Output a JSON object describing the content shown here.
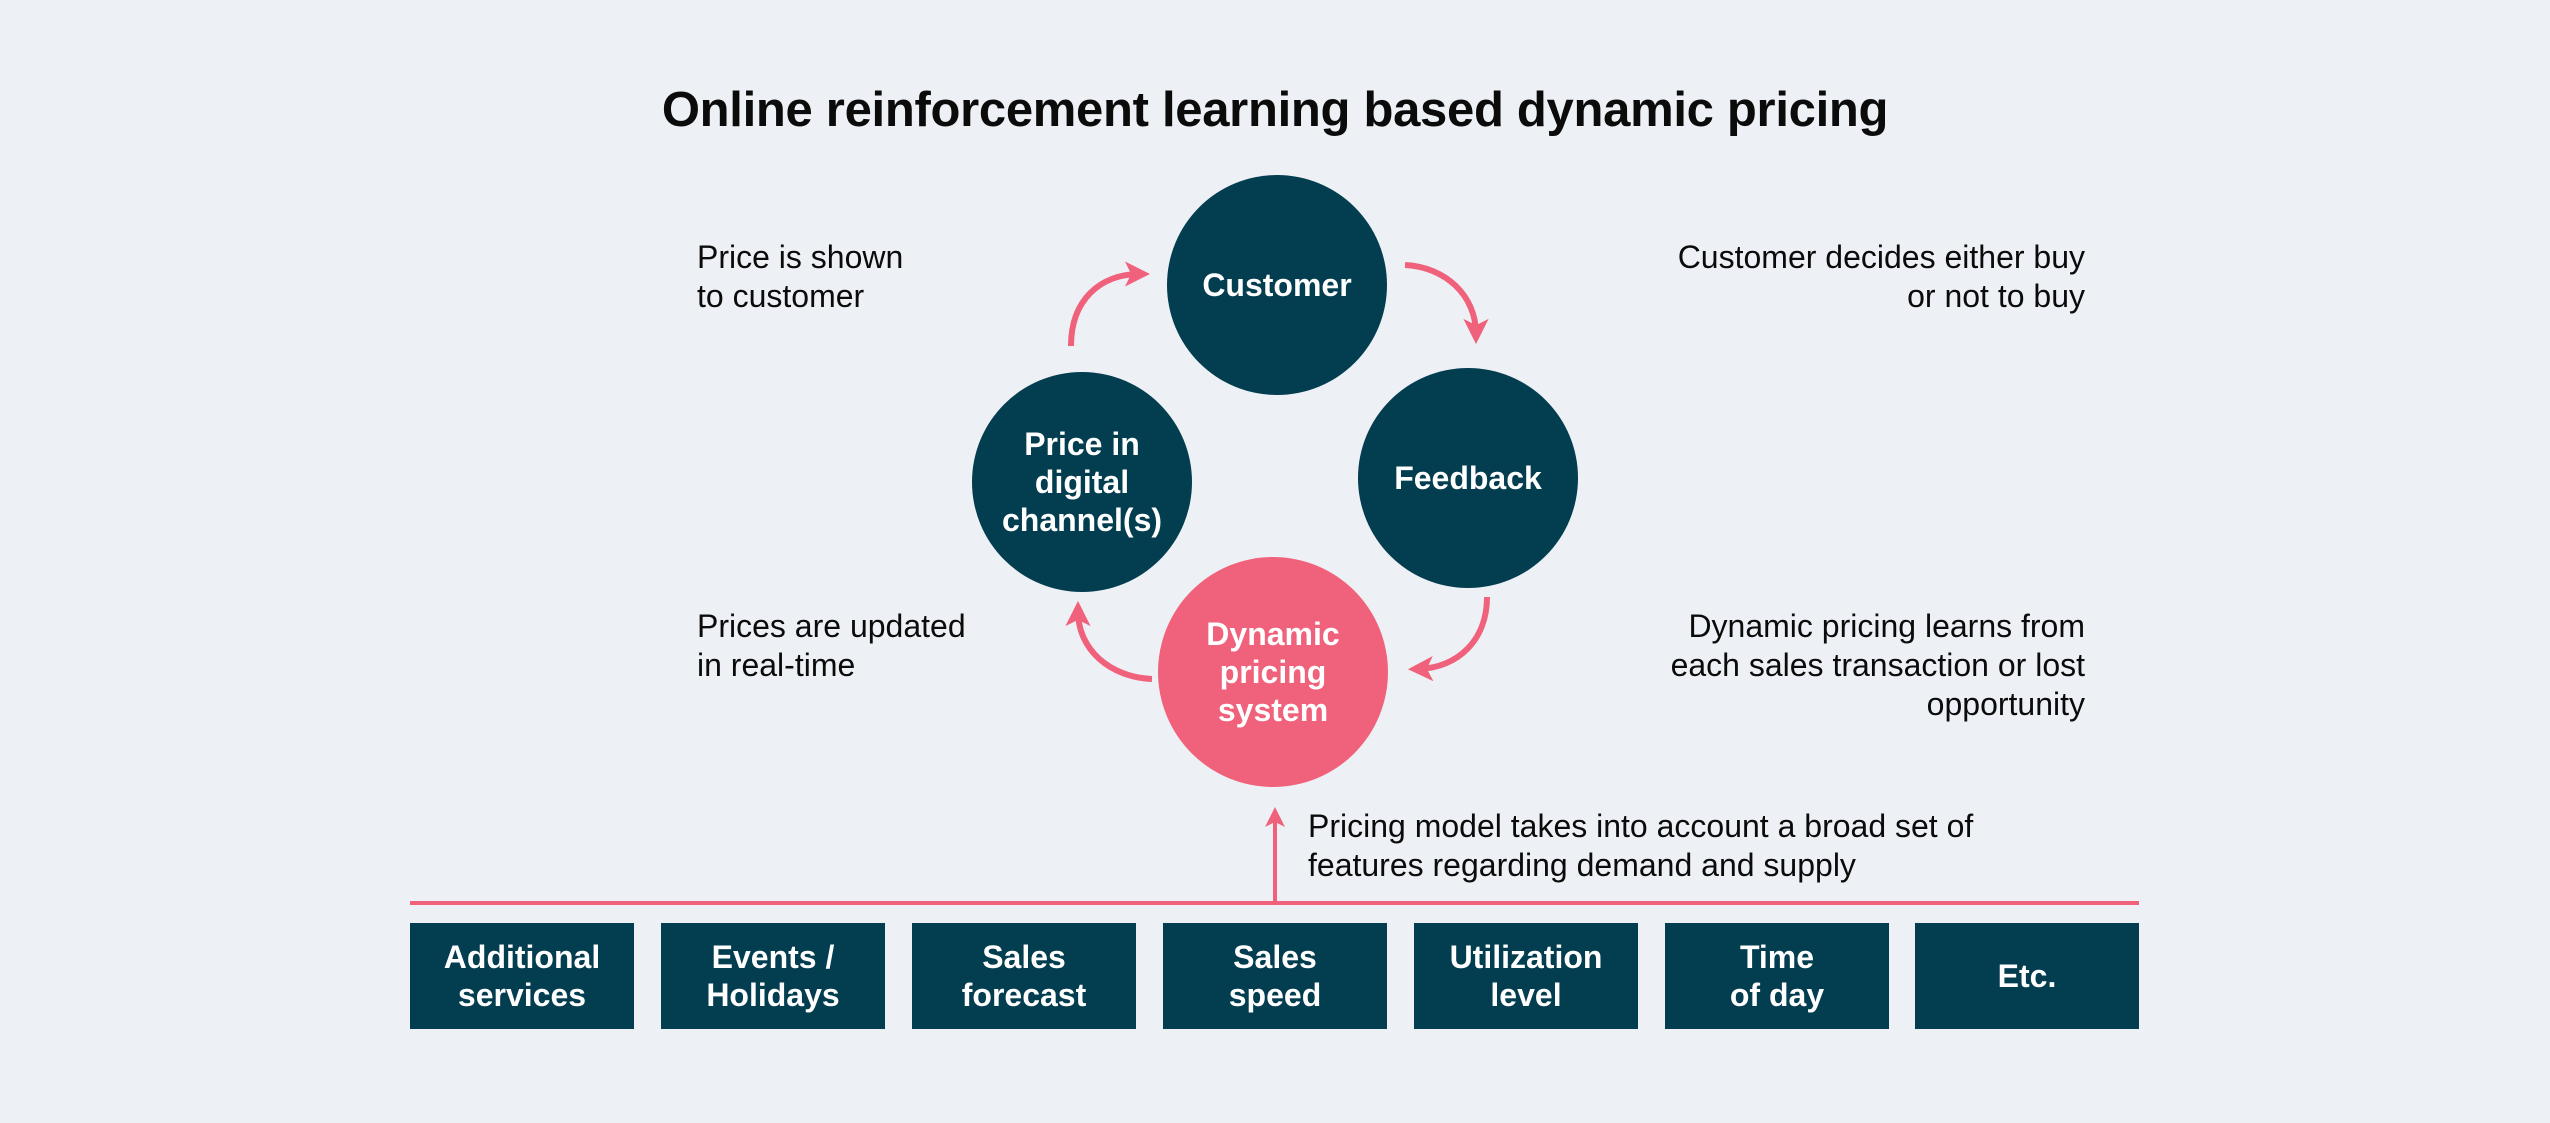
{
  "title": "Online reinforcement learning based dynamic pricing",
  "colors": {
    "background": "#EDF1F5",
    "dark_teal": "#033D50",
    "pink": "#F0627B"
  },
  "cycle": {
    "nodes": [
      {
        "id": "customer",
        "label": "Customer"
      },
      {
        "id": "feedback",
        "label": "Feedback"
      },
      {
        "id": "dynamic-pricing-system",
        "label": "Dynamic\npricing\nsystem"
      },
      {
        "id": "price-in-digital-channels",
        "label": "Price in\ndigital\nchannel(s)"
      }
    ],
    "notes": [
      {
        "id": "price-shown",
        "text": "Price is shown\nto customer"
      },
      {
        "id": "customer-decides",
        "text": "Customer decides either buy\nor not to buy"
      },
      {
        "id": "prices-updated",
        "text": "Prices are updated\nin real-time"
      },
      {
        "id": "dynamic-learns",
        "text": "Dynamic pricing learns from\neach sales transaction or lost\nopportunity"
      }
    ]
  },
  "features_note": "Pricing model takes into account a broad set of\nfeatures regarding demand and supply",
  "features": [
    "Additional\nservices",
    "Events /\nHolidays",
    "Sales\nforecast",
    "Sales\nspeed",
    "Utilization\nlevel",
    "Time\nof day",
    "Etc."
  ]
}
